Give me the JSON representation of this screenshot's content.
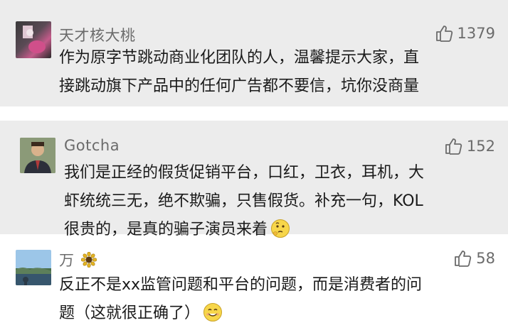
{
  "comments": [
    {
      "username": "天才核大桃",
      "likes": "1379",
      "lines": [
        "作为原字节跳动商业化团队的人，温馨提示大家，直",
        "接跳动旗下产品中的任何广告都不要信，坑你没商量"
      ],
      "avatar_icon": "avatar-cartoon-pink-icon"
    },
    {
      "username": "Gotcha",
      "likes": "152",
      "lines": [
        "我们是正经的假货促销平台，口红，卫衣，耳机，大",
        "虾统统三无，绝不欺骗，只售假货。补充一句，KOL",
        "很贵的，是真的骗子演员来着"
      ],
      "trailing_emoji": "thinking-face-emoji",
      "avatar_icon": "avatar-man-suit-icon"
    },
    {
      "username": "万",
      "username_icon": "sunflower-icon",
      "likes": "58",
      "lines": [
        "反正不是xx监管问题和平台的问题，而是消费者的问",
        "题（这就很正确了）"
      ],
      "trailing_emoji": "smiling-face-emoji",
      "avatar_icon": "avatar-landscape-icon"
    }
  ],
  "colors": {
    "text": "#1a1a1a",
    "meta": "#6b6b6b",
    "background_alt": "#ececec",
    "background": "#ffffff"
  }
}
